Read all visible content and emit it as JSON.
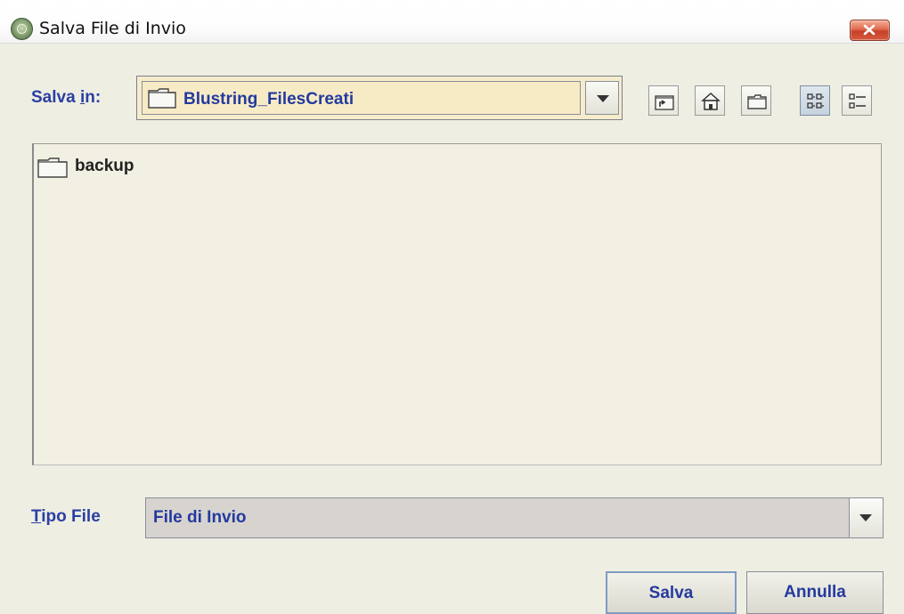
{
  "window": {
    "title": "Salva File di Invio"
  },
  "icons": {
    "app": "emblem-icon",
    "close": "close-icon",
    "folder": "folder-icon",
    "up": "up-folder-icon",
    "home": "home-icon",
    "new_folder": "new-folder-icon",
    "list_view": "list-view-icon",
    "details_view": "details-view-icon",
    "dropdown": "chevron-down-icon"
  },
  "location": {
    "label_prefix": "Salva ",
    "label_underlined": "i",
    "label_suffix": "n:",
    "selected": "Blustring_FilesCreati"
  },
  "files": [
    {
      "name": "backup",
      "type": "folder"
    }
  ],
  "file_type": {
    "label_underlined": "T",
    "label_rest": "ipo File",
    "selected": "File di Invio"
  },
  "buttons": {
    "save": "Salva",
    "cancel": "Annulla"
  },
  "colors": {
    "accent_text": "#2b3fa3",
    "dialog_bg": "#eeeee2",
    "combo_highlight": "#f6eccb",
    "close_button": "#d04a30"
  }
}
